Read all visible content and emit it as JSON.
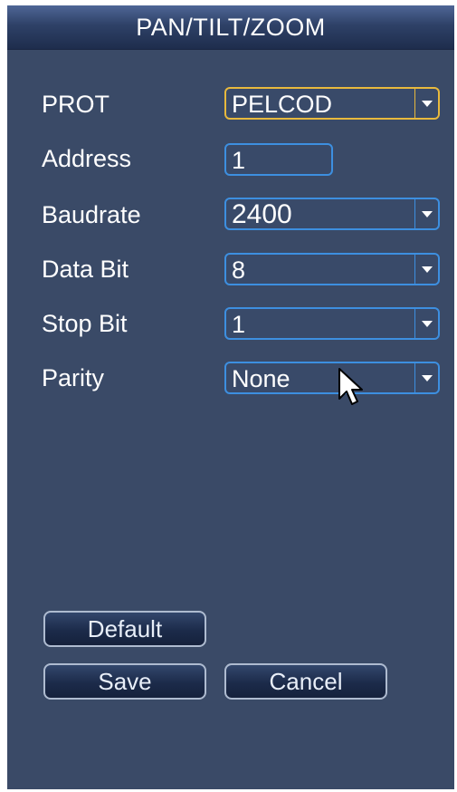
{
  "window": {
    "title": "PAN/TILT/ZOOM"
  },
  "form": {
    "fields": [
      {
        "label": "PROT",
        "value": "PELCOD",
        "type": "select"
      },
      {
        "label": "Address",
        "value": "1",
        "type": "input"
      },
      {
        "label": "Baudrate",
        "value": "2400",
        "type": "select"
      },
      {
        "label": "Data Bit",
        "value": "8",
        "type": "select"
      },
      {
        "label": "Stop Bit",
        "value": "1",
        "type": "select"
      },
      {
        "label": "Parity",
        "value": "None",
        "type": "select"
      }
    ]
  },
  "buttons": {
    "default": "Default",
    "save": "Save",
    "cancel": "Cancel"
  },
  "colors": {
    "panel": "#3a4a67",
    "field_border": "#3d8fe0",
    "focus_border": "#e8b93d"
  },
  "icons": {
    "dropdown": "chevron-down-icon",
    "cursor": "mouse-pointer-icon"
  }
}
